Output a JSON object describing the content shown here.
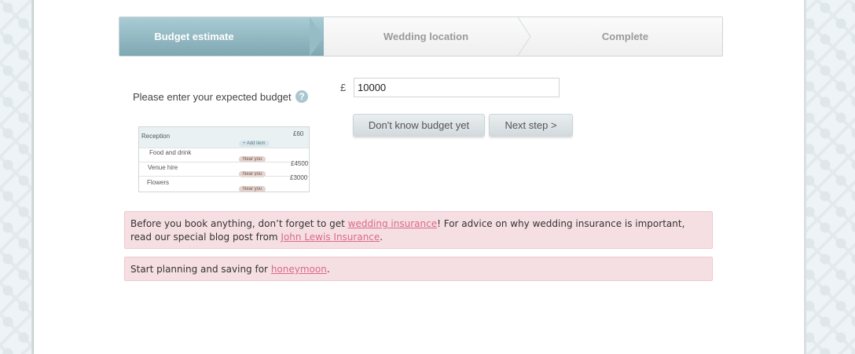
{
  "steps": [
    {
      "label": "Budget estimate",
      "active": true
    },
    {
      "label": "Wedding location",
      "active": false
    },
    {
      "label": "Complete",
      "active": false
    }
  ],
  "budget": {
    "label": "Please enter your expected budget",
    "help_icon": "question-mark-icon",
    "currency": "£",
    "value": "10000"
  },
  "buttons": {
    "dont_know": "Don't know budget yet",
    "next_step": "Next step >"
  },
  "preview": {
    "header": {
      "label": "Reception",
      "amount": "£60",
      "add_label": "+ Add item"
    },
    "rows": [
      {
        "label": "Food and drink",
        "pill": "Near you",
        "amount": "£4500"
      },
      {
        "label": "Venue hire",
        "pill": "Near you",
        "amount": "£3000"
      },
      {
        "label": "Flowers",
        "pill": "Near you",
        "amount": ""
      }
    ]
  },
  "notices": {
    "insurance": {
      "before": "Before you book anything, don’t forget to get ",
      "link1": "wedding insurance",
      "middle": "! For advice on why wedding insurance is important, read our special blog post from ",
      "link2": "John Lewis Insurance",
      "after": "."
    },
    "honeymoon": {
      "before": "Start planning and saving for ",
      "link": "honeymoon",
      "after": "."
    }
  },
  "colors": {
    "active_step": "#8fb5bf",
    "notice_bg": "#f6dfe3",
    "link": "#d96a8a"
  }
}
